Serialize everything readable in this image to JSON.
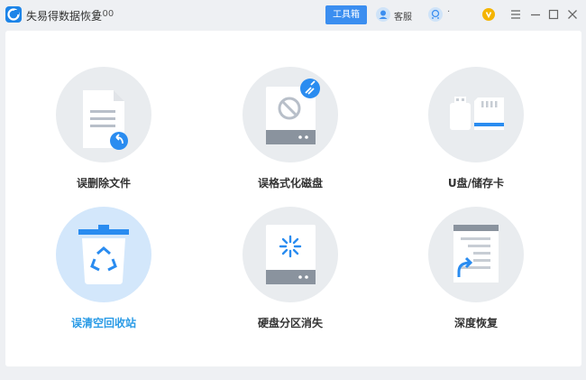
{
  "window": {
    "title": "失易得数据恢复",
    "version": "7.00",
    "toolbox_label": "工具箱",
    "service_label": "客服",
    "user_label": "·",
    "icons": [
      "app-logo-icon",
      "service-icon",
      "user-icon",
      "vip-icon",
      "menu-icon",
      "minimize-icon",
      "maximize-icon",
      "close-icon"
    ]
  },
  "tiles": [
    {
      "label": "误删除文件",
      "icon": "deleted-file-icon"
    },
    {
      "label": "误格式化磁盘",
      "icon": "formatted-disk-icon"
    },
    {
      "label": "U盘/储存卡",
      "icon": "usb-sdcard-icon"
    },
    {
      "label": "误清空回收站",
      "icon": "recycle-bin-icon",
      "active": true
    },
    {
      "label": "硬盘分区消失",
      "icon": "lost-partition-icon"
    },
    {
      "label": "深度恢复",
      "icon": "deep-recovery-icon"
    }
  ],
  "colors": {
    "accent": "#3b8ef0",
    "active_text": "#2a9be6",
    "circle": "#e9ecef",
    "active_circle": "#d3e7fb"
  }
}
